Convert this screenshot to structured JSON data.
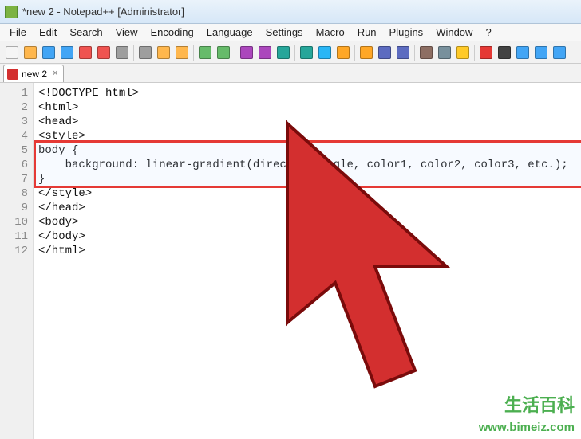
{
  "titlebar": {
    "title": "*new 2 - Notepad++ [Administrator]"
  },
  "menubar": {
    "items": [
      "File",
      "Edit",
      "Search",
      "View",
      "Encoding",
      "Language",
      "Settings",
      "Macro",
      "Run",
      "Plugins",
      "Window",
      "?"
    ]
  },
  "toolbar": {
    "icons": [
      "new",
      "open",
      "save",
      "save-all",
      "close",
      "close-all",
      "print",
      "cut",
      "copy",
      "paste",
      "undo",
      "redo",
      "find",
      "replace",
      "zoom-in",
      "zoom-out",
      "sync",
      "wrap",
      "all-chars",
      "indent",
      "fold",
      "unfold",
      "hide",
      "bookmark",
      "record",
      "stop",
      "play",
      "play-multi",
      "ff"
    ]
  },
  "tabs": {
    "items": [
      {
        "label": "new 2",
        "modified": true
      }
    ]
  },
  "editor": {
    "lines": [
      "<!DOCTYPE html>",
      "<html>",
      "<head>",
      "<style>",
      "body {",
      "    background: linear-gradient(direction/angle, color1, color2, color3, etc.);",
      "}",
      "</style>",
      "</head>",
      "<body>",
      "</body>",
      "</html>"
    ],
    "highlighted_lines": [
      5,
      6,
      7
    ]
  },
  "watermark": {
    "cn": "生活百科",
    "url": "www.bimeiz.com"
  },
  "toolbar_colors": {
    "new": "#f5f5f5",
    "open": "#ffb74d",
    "save": "#42a5f5",
    "save-all": "#42a5f5",
    "close": "#ef5350",
    "close-all": "#ef5350",
    "print": "#9e9e9e",
    "cut": "#9e9e9e",
    "copy": "#ffb74d",
    "paste": "#ffb74d",
    "undo": "#66bb6a",
    "redo": "#66bb6a",
    "find": "#ab47bc",
    "replace": "#ab47bc",
    "zoom-in": "#26a69a",
    "zoom-out": "#26a69a",
    "sync": "#29b6f6",
    "wrap": "#ffa726",
    "all-chars": "#ffa726",
    "indent": "#5c6bc0",
    "fold": "#5c6bc0",
    "unfold": "#8d6e63",
    "hide": "#78909c",
    "bookmark": "#ffca28",
    "record": "#e53935",
    "stop": "#424242",
    "play": "#42a5f5",
    "play-multi": "#42a5f5",
    "ff": "#42a5f5"
  }
}
